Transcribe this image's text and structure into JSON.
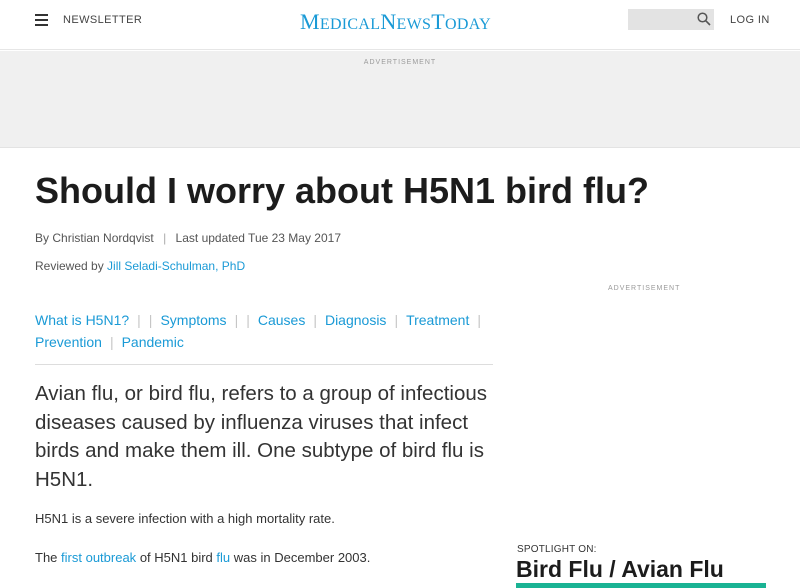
{
  "header": {
    "newsletter": "NEWSLETTER",
    "logo_medical": "Medical",
    "logo_news": "News",
    "logo_today": "Today",
    "search_placeholder": "",
    "login": "LOG IN"
  },
  "ads": {
    "top_label": "ADVERTISEMENT",
    "side_label": "ADVERTISEMENT"
  },
  "article": {
    "title": "Should I worry about H5N1 bird flu?",
    "by_prefix": "By",
    "author": "Christian Nordqvist",
    "updated": "Last updated Tue 23 May 2017",
    "reviewed_prefix": "Reviewed by",
    "reviewer": "Jill Seladi-Schulman, PhD",
    "toc": [
      "What is H5N1?",
      "Symptoms",
      "Causes",
      "Diagnosis",
      "Treatment",
      "Prevention",
      "Pandemic"
    ],
    "lede": "Avian flu, or bird flu, refers to a group of infectious diseases caused by influenza viruses that infect birds and make them ill. One subtype of bird flu is H5N1.",
    "para1": "H5N1 is a severe infection with a high mortality rate.",
    "para2_a": "The",
    "para2_link1": "first outbreak",
    "para2_b": "of H5N1 bird",
    "para2_link2": "flu",
    "para2_c": "was in December 2003."
  },
  "spotlight": {
    "label": "SPOTLIGHT ON:",
    "title": "Bird Flu / Avian Flu"
  },
  "colors": {
    "brand": "#1a9ad6",
    "spotlight_accent": "#1ab394",
    "ad_background": "#f0f0f0"
  }
}
